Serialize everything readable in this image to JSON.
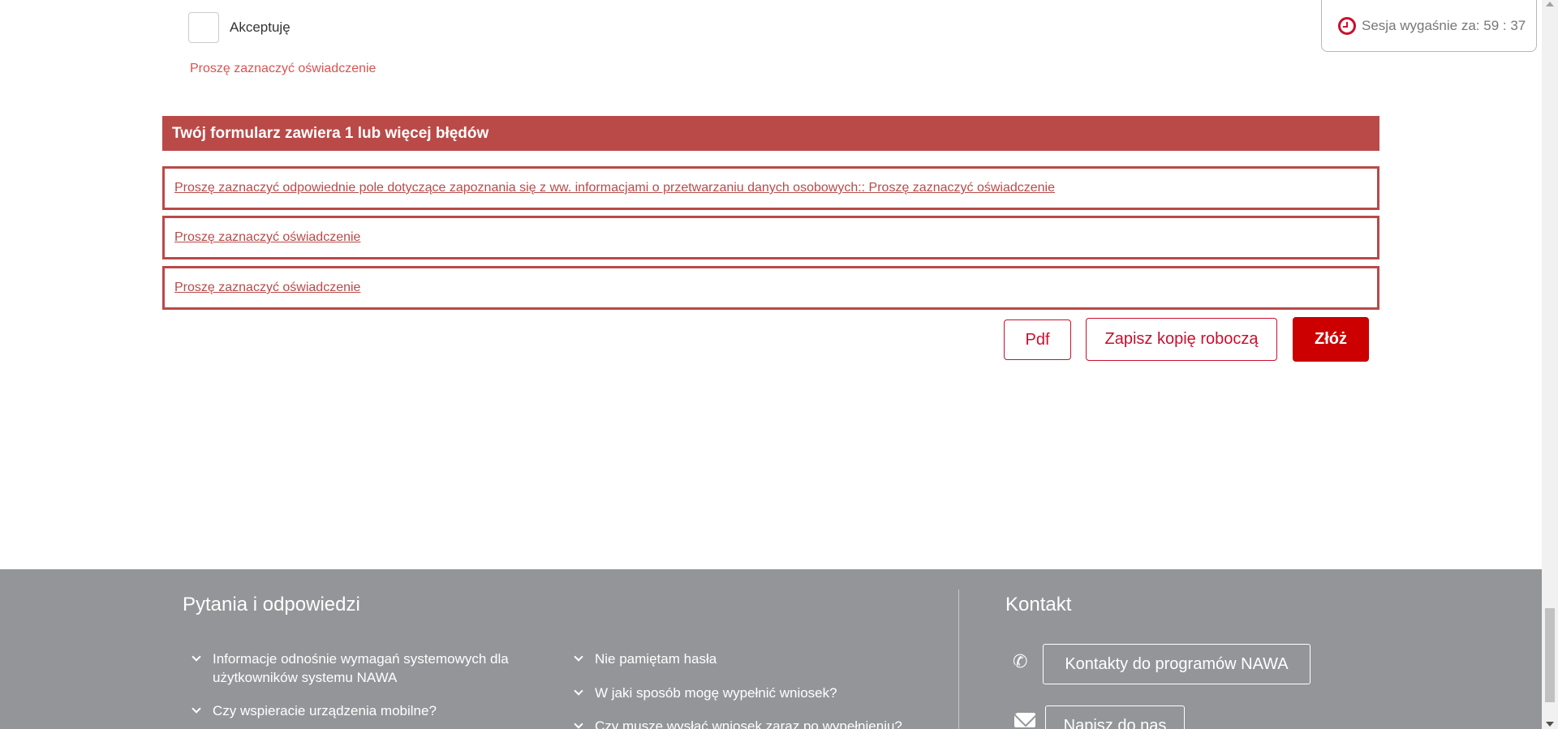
{
  "session": {
    "label": "Sesja wygaśnie za: 59 : 37",
    "icon": "clock-icon"
  },
  "consent": {
    "checkbox_label": "Akceptuję",
    "field_error": "Proszę zaznaczyć oświadczenie"
  },
  "error_summary": {
    "title": "Twój formularz zawiera 1 lub więcej błędów",
    "items": [
      "Proszę zaznaczyć odpowiednie pole dotyczące zapoznania się z ww. informacjami o przetwarzaniu danych osobowych:: Proszę zaznaczyć oświadczenie",
      "Proszę zaznaczyć oświadczenie",
      "Proszę zaznaczyć oświadczenie"
    ]
  },
  "actions": {
    "pdf_label": "Pdf",
    "save_draft_label": "Zapisz kopię roboczą",
    "submit_label": "Złóż"
  },
  "footer": {
    "faq_title": "Pytania i odpowiedzi",
    "faq_items": [
      "Informacje odnośnie wymagań systemowych dla użytkowników systemu NAWA",
      "Czy wspieracie urządzenia mobilne?",
      "Nie pamiętam hasła",
      "W jaki sposób mogę wypełnić wniosek?",
      "Czy muszę wysłać wniosek zaraz po wypełnieniu?"
    ],
    "contact_title": "Kontakt",
    "contact_programs_label": "Kontakty do programów NAWA",
    "write_to_us_label": "Napisz do nas"
  },
  "colors": {
    "accent": "#c8102e",
    "error": "#b94a48",
    "footer_bg": "#939598"
  }
}
